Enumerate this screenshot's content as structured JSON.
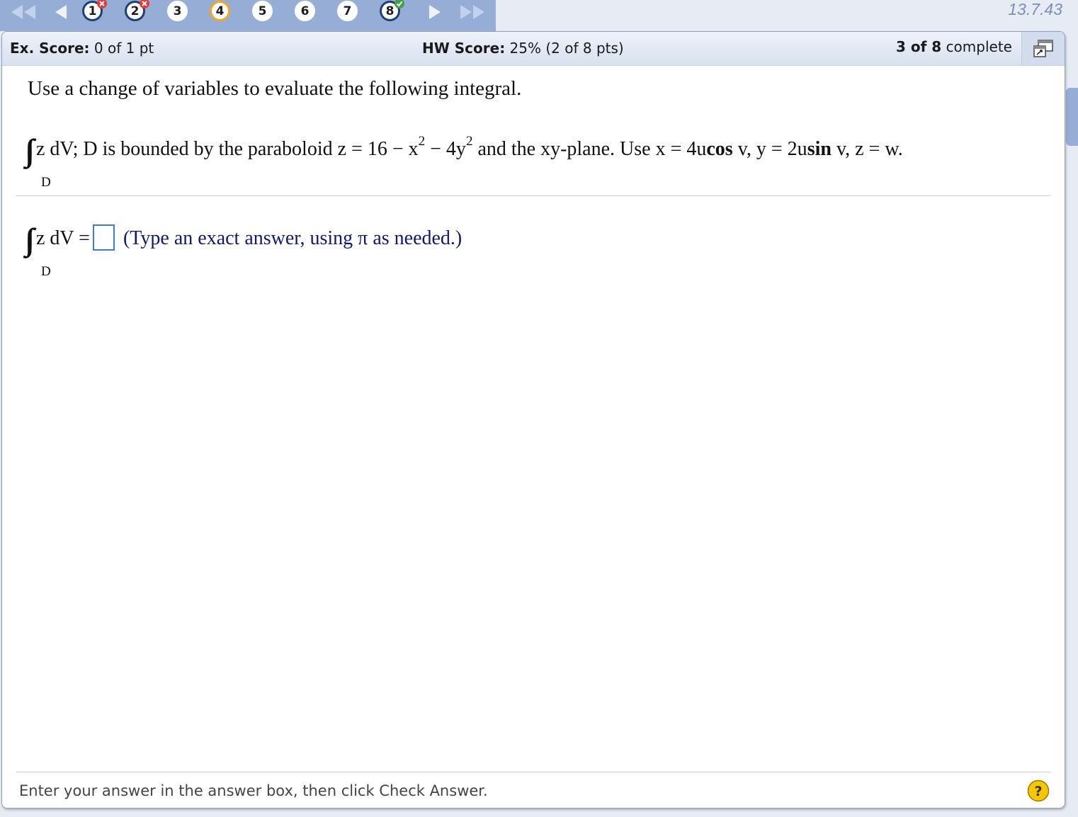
{
  "nav": {
    "questions": [
      {
        "num": "1",
        "state": "visited",
        "mark": "wrong"
      },
      {
        "num": "2",
        "state": "visited",
        "mark": "wrong"
      },
      {
        "num": "3",
        "state": "default",
        "mark": ""
      },
      {
        "num": "4",
        "state": "current",
        "mark": ""
      },
      {
        "num": "5",
        "state": "default",
        "mark": ""
      },
      {
        "num": "6",
        "state": "default",
        "mark": ""
      },
      {
        "num": "7",
        "state": "default",
        "mark": ""
      },
      {
        "num": "8",
        "state": "visited",
        "mark": "correct"
      }
    ],
    "version": "13.7.43"
  },
  "scores": {
    "ex_label": "Ex. Score:",
    "ex_value": "0 of 1 pt",
    "hw_label": "HW Score:",
    "hw_value": "25% (2 of 8 pts)",
    "complete_bold": "3 of 8",
    "complete_text": "complete"
  },
  "question": {
    "instruction": "Use a change of variables to evaluate the following integral.",
    "integrand": "z dV; D is bounded by the paraboloid z = 16 − x",
    "exp1": "2",
    "mid": " − 4y",
    "exp2": "2",
    "tail1": " and the xy-plane. Use x = 4u",
    "cos": "cos",
    "tail2": " v, y = 2u",
    "sin": "sin",
    "tail3": " v, z = w.",
    "region": "D"
  },
  "answer": {
    "lhs": "z dV =",
    "hint": "(Type an exact answer, using π as needed.)",
    "value": "",
    "region": "D"
  },
  "footer": {
    "text": "Enter your answer in the answer box, then click Check Answer."
  },
  "colors": {
    "strip": "#96aed6",
    "hint": "#0f1875",
    "current": "#f5a623",
    "visited": "#1f3f78",
    "wrong": "#e53935",
    "correct": "#43a047"
  }
}
